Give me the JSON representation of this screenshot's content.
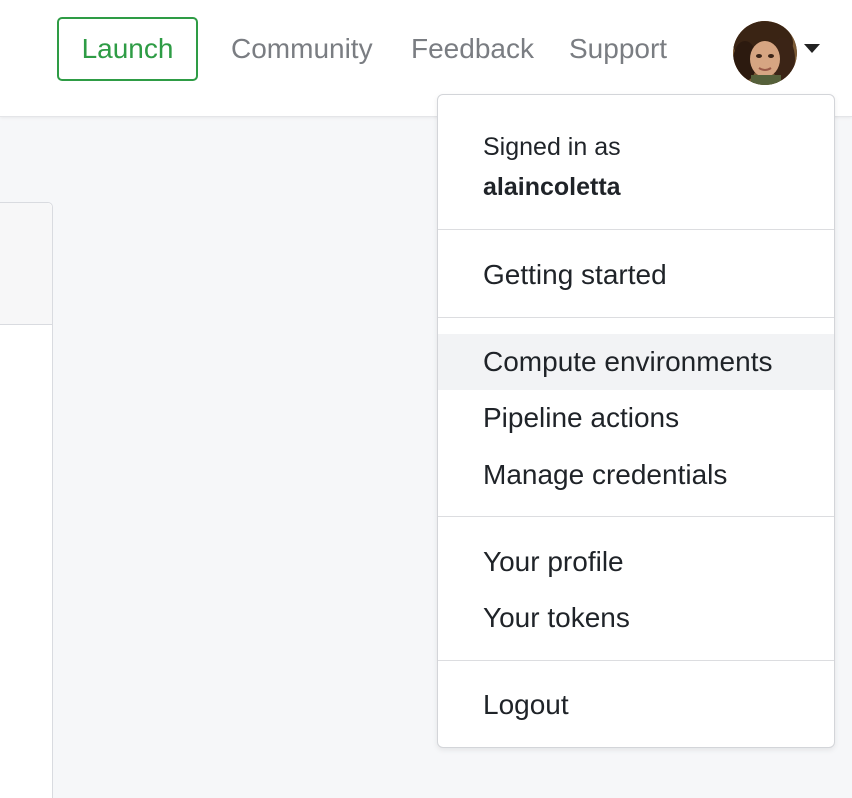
{
  "header": {
    "launch_label": "Launch",
    "nav": {
      "community": "Community",
      "feedback": "Feedback",
      "support": "Support"
    }
  },
  "user_menu": {
    "signed_in_label": "Signed in as",
    "username": "alaincoletta",
    "items": {
      "getting_started": "Getting started",
      "compute_environments": "Compute environments",
      "pipeline_actions": "Pipeline actions",
      "manage_credentials": "Manage credentials",
      "your_profile": "Your profile",
      "your_tokens": "Your tokens",
      "logout": "Logout"
    },
    "highlighted_item": "Compute environments"
  },
  "colors": {
    "launch_accent": "#2e9c45",
    "nav_text": "#7a7d82",
    "menu_text": "#1f2328",
    "page_background": "#f6f7f9",
    "hover_background": "#f2f3f5"
  },
  "icons": {
    "avatar": "user-avatar",
    "dropdown_toggle": "caret-down-icon"
  }
}
